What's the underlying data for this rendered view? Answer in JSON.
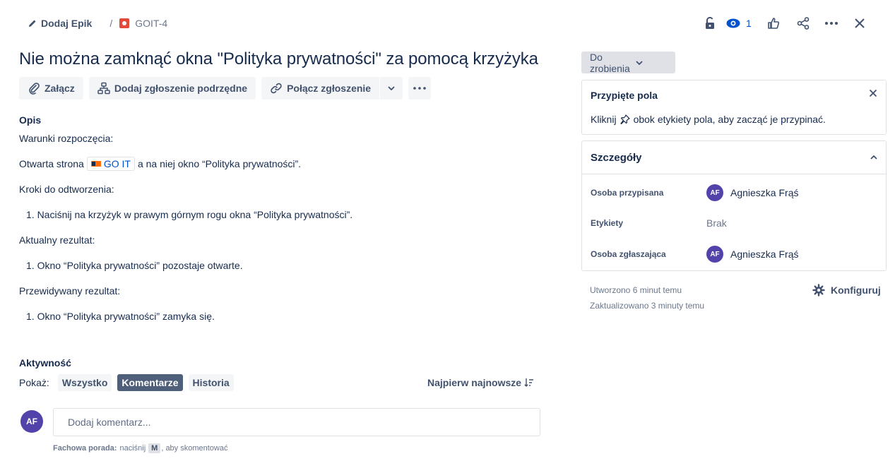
{
  "breadcrumb": {
    "epic_label": "Dodaj Epik",
    "separator": "/",
    "issue_key": "GOIT-4"
  },
  "header": {
    "watchers_count": "1"
  },
  "issue": {
    "title": "Nie można zamknąć okna \"Polityka prywatności\" za pomocą krzyżyka"
  },
  "actions": {
    "attach": "Załącz",
    "add_child": "Dodaj zgłoszenie podrzędne",
    "link_issue": "Połącz zgłoszenie"
  },
  "description": {
    "heading": "Opis",
    "preconditions": "Warunki rozpoczęcia:",
    "open_prefix": "Otwarta strona",
    "link_text": "GO IT",
    "open_suffix": "a na niej okno “Polityka prywatności”.",
    "steps_heading": "Kroki do odtworzenia:",
    "step_1": "1.  Naciśnij na krzyżyk w prawym górnym rogu okna “Polityka prywatności”.",
    "actual_heading": "Aktualny rezultat:",
    "actual_1": "1. Okno “Polityka prywatności” pozostaje otwarte.",
    "expected_heading": "Przewidywany rezultat:",
    "expected_1": "1. Okno “Polityka prywatności” zamyka się."
  },
  "activity": {
    "heading": "Aktywność",
    "show_label": "Pokaż:",
    "filters": [
      "Wszystko",
      "Komentarze",
      "Historia"
    ],
    "active_filter": "Komentarze",
    "sort_label": "Najpierw najnowsze",
    "avatar_initials": "AF",
    "comment_placeholder": "Dodaj komentarz...",
    "protip_bold": "Fachowa porada:",
    "protip_press": "naciśnij",
    "protip_key": "M",
    "protip_suffix": ", aby skomentować"
  },
  "sidebar": {
    "status": "Do zrobienia",
    "pinned": {
      "title": "Przypięte pola",
      "hint_prefix": "Kliknij",
      "hint_suffix": "obok etykiety pola, aby zacząć je przypinać."
    },
    "details": {
      "title": "Szczegóły",
      "assignee_label": "Osoba przypisana",
      "assignee_name": "Agnieszka Frąś",
      "assignee_initials": "AF",
      "labels_label": "Etykiety",
      "labels_value": "Brak",
      "reporter_label": "Osoba zgłaszająca",
      "reporter_name": "Agnieszka Frąś",
      "reporter_initials": "AF"
    },
    "created": "Utworzono 6 minut temu",
    "updated": "Zaktualizowano 3 minuty temu",
    "configure": "Konfiguruj"
  },
  "colors": {
    "accent": "#0052cc",
    "avatar": "#5243aa",
    "bug": "#e5493a",
    "text": "#172b4d"
  },
  "icons": [
    "pencil-icon",
    "bug-icon",
    "lock-icon",
    "eye-icon",
    "thumbs-up-icon",
    "share-icon",
    "more-icon",
    "close-icon",
    "paperclip-icon",
    "hierarchy-icon",
    "link-icon",
    "chevron-down-icon",
    "pin-icon",
    "chevron-up-icon",
    "sort-icon",
    "gear-icon"
  ]
}
